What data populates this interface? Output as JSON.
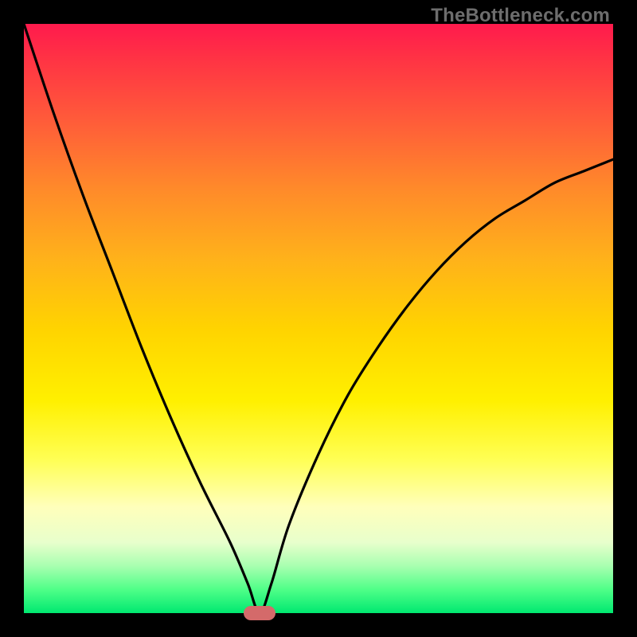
{
  "watermark": "TheBottleneck.com",
  "colors": {
    "frame": "#000000",
    "gradient_top": "#ff1a4d",
    "gradient_bottom": "#00e870",
    "curve": "#000000",
    "marker": "#d46a6a"
  },
  "chart_data": {
    "type": "line",
    "title": "",
    "xlabel": "",
    "ylabel": "",
    "xlim": [
      0,
      100
    ],
    "ylim": [
      0,
      100
    ],
    "x": [
      0,
      5,
      10,
      15,
      20,
      25,
      30,
      35,
      38,
      40,
      42,
      45,
      50,
      55,
      60,
      65,
      70,
      75,
      80,
      85,
      90,
      95,
      100
    ],
    "series": [
      {
        "name": "bottleneck-curve",
        "values": [
          100,
          85,
          71,
          58,
          45,
          33,
          22,
          12,
          5,
          0,
          5,
          15,
          27,
          37,
          45,
          52,
          58,
          63,
          67,
          70,
          73,
          75,
          77
        ]
      }
    ],
    "marker": {
      "x": 40,
      "y": 0,
      "shape": "pill"
    },
    "grid": false,
    "legend": false
  }
}
